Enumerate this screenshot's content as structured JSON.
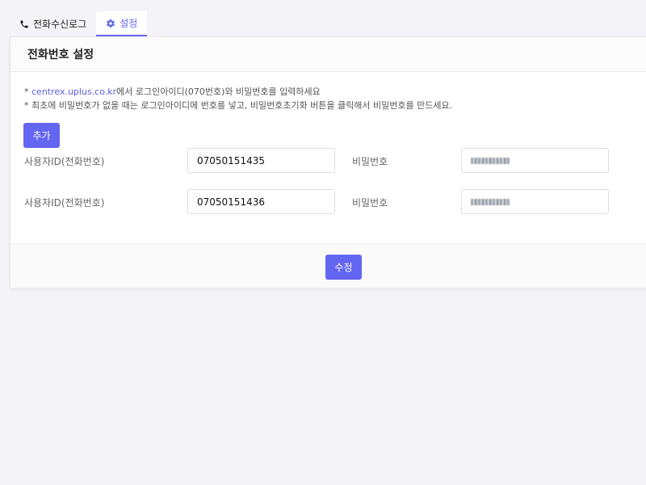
{
  "tabs": [
    {
      "label": "전화수신로그",
      "icon": "phone-icon",
      "active": false
    },
    {
      "label": "설정",
      "icon": "gear-icon",
      "active": true
    }
  ],
  "card": {
    "title": "전화번호 설정",
    "notes": {
      "line1_prefix": "* ",
      "line1_link": "centrex.uplus.co.kr",
      "line1_suffix": "에서 로그인아이디(070번호)와 비밀번호를 입력하세요",
      "line2": "* 최초에 비밀번호가 없을 때는 로그인아이디에 번호를 넣고, 비밀번호초기화 버튼을 클릭해서 비밀번호를 만드세요."
    },
    "add_button": "추가",
    "rows": [
      {
        "user_label": "사용자ID(전화번호)",
        "user_value": "07050151435",
        "password_label": "비밀번호"
      },
      {
        "user_label": "사용자ID(전화번호)",
        "user_value": "07050151436",
        "password_label": "비밀번호"
      }
    ],
    "save_button": "수정"
  },
  "colors": {
    "accent": "#6366f1",
    "link": "#5b5fe0"
  }
}
